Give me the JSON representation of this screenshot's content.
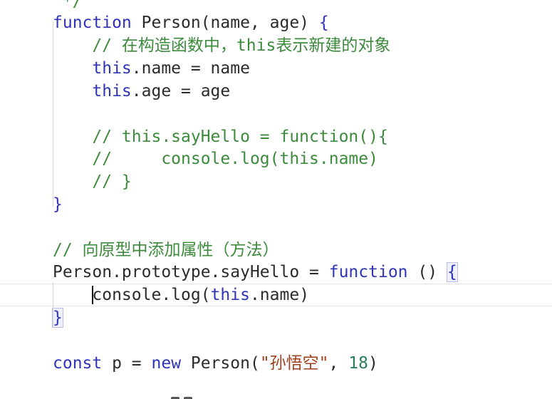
{
  "editor": {
    "lines": [
      {
        "text": " */",
        "kind": "comment"
      },
      {
        "parts": [
          [
            "kw",
            "function"
          ],
          [
            "plain",
            " Person(name, age) "
          ],
          [
            "bracket",
            "{"
          ]
        ]
      },
      {
        "parts": [
          [
            "cmt",
            "    // 在构造函数中，this表示新建的对象"
          ]
        ]
      },
      {
        "parts": [
          [
            "kw",
            "    this"
          ],
          [
            "plain",
            ".name = name"
          ]
        ]
      },
      {
        "parts": [
          [
            "kw",
            "    this"
          ],
          [
            "plain",
            ".age = age"
          ]
        ]
      },
      {
        "parts": []
      },
      {
        "parts": [
          [
            "cmt",
            "    // this.sayHello = function(){"
          ]
        ]
      },
      {
        "parts": [
          [
            "cmt",
            "    //     console.log(this.name)"
          ]
        ]
      },
      {
        "parts": [
          [
            "cmt",
            "    // }"
          ]
        ]
      },
      {
        "parts": [
          [
            "bracket",
            "}"
          ]
        ]
      },
      {
        "parts": []
      },
      {
        "parts": [
          [
            "cmt",
            "// 向原型中添加属性（方法）"
          ]
        ]
      },
      {
        "parts": [
          [
            "plain",
            "Person.prototype.sayHello = "
          ],
          [
            "kw",
            "function"
          ],
          [
            "plain",
            " () "
          ],
          [
            "match",
            "{"
          ]
        ]
      },
      {
        "parts": [
          [
            "plain",
            "    "
          ],
          [
            "caret",
            ""
          ],
          [
            "plain",
            "console.log("
          ],
          [
            "kw",
            "this"
          ],
          [
            "plain",
            ".name)"
          ]
        ],
        "current": true
      },
      {
        "parts": [
          [
            "match",
            "}"
          ]
        ]
      },
      {
        "parts": []
      },
      {
        "parts": [
          [
            "kw",
            "const"
          ],
          [
            "plain",
            " p = "
          ],
          [
            "kw",
            "new"
          ],
          [
            "plain",
            " Person("
          ],
          [
            "str",
            "\"孙悟空\""
          ],
          [
            "plain",
            ", "
          ],
          [
            "num",
            "18"
          ],
          [
            "plain",
            ")"
          ]
        ]
      }
    ]
  },
  "colors": {
    "keyword": "#2f34b8",
    "comment": "#3c8a3c",
    "string": "#a0401c",
    "number": "#2b7f5a",
    "text": "#2b2b2b"
  }
}
